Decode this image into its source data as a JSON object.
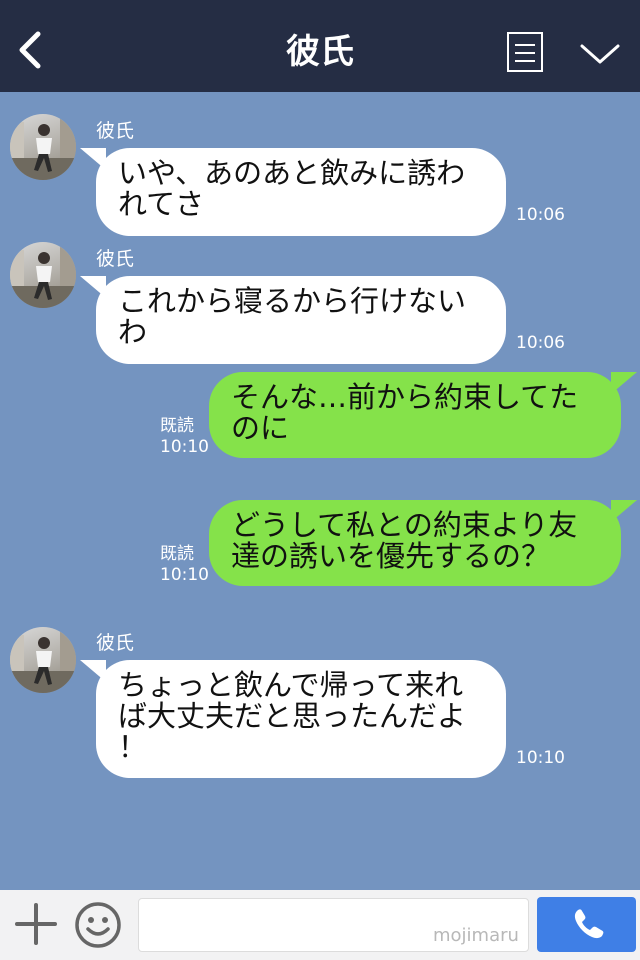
{
  "header": {
    "title": "彼氏",
    "back_icon": "chevron-left-icon",
    "menu_icon": "menu-list-icon",
    "collapse_icon": "chevron-down-icon"
  },
  "messages": [
    {
      "direction": "in",
      "sender": "彼氏",
      "lines": [
        "いや、あのあと飲みに誘わ",
        "れてさ"
      ],
      "time": "10:06"
    },
    {
      "direction": "in",
      "sender": "彼氏",
      "lines": [
        "これから寝るから行けない",
        "わ"
      ],
      "time": "10:06"
    },
    {
      "direction": "out",
      "read": "既読",
      "lines": [
        "そんな…前から約束してた",
        "のに"
      ],
      "time": "10:10"
    },
    {
      "direction": "out",
      "read": "既読",
      "lines": [
        "どうして私との約束より友",
        "達の誘いを優先するの？"
      ],
      "time": "10:10"
    },
    {
      "direction": "in",
      "sender": "彼氏",
      "lines": [
        "ちょっと飲んで帰って来れ",
        "ば大丈夫だと思ったんだよ",
        "！"
      ],
      "time": "10:10"
    }
  ],
  "footer": {
    "plus_icon": "plus-icon",
    "emoji_icon": "smiley-icon",
    "input_value": "",
    "watermark": "mojimaru",
    "call_icon": "phone-icon"
  },
  "colors": {
    "header_bg": "#252d44",
    "chat_bg": "#7494c0",
    "outgoing_bubble": "#85e24a",
    "incoming_bubble": "#ffffff",
    "call_button": "#3f7fe6"
  }
}
